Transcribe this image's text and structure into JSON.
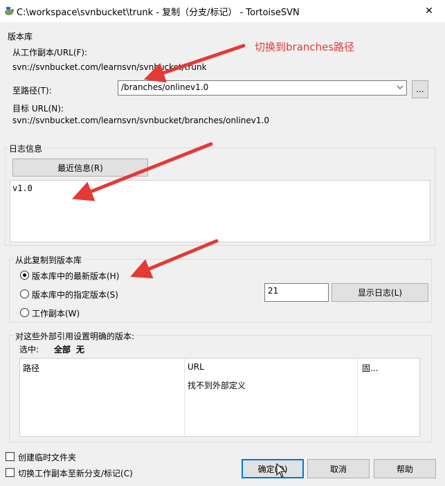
{
  "window": {
    "title": "C:\\workspace\\svnbucket\\trunk - 复制（分支/标记） - TortoiseSVN",
    "close_glyph": "✕"
  },
  "repository": {
    "group_label": "版本库",
    "from_label": "从工作副本/URL(F):",
    "from_url": "svn://svnbucket.com/learnsvn/svnbucket/trunk",
    "to_label": "至路径(T):",
    "to_value": "/branches/onlinev1.0",
    "browse_label": "...",
    "target_label": "目标 URL(N):",
    "target_url": "svn://svnbucket.com/learnsvn/svnbucket/branches/onlinev1.0"
  },
  "log": {
    "group_label": "日志信息",
    "recent_button": "最近信息(R)",
    "message": "v1.0"
  },
  "copy_from": {
    "group_label": "从此复制到版本库",
    "options": [
      {
        "label": "版本库中的最新版本(H)",
        "checked": true
      },
      {
        "label": "版本库中的指定版本(S)",
        "checked": false
      },
      {
        "label": "工作副本(W)",
        "checked": false
      }
    ],
    "revision_value": "21",
    "show_log_button": "显示日志(L)"
  },
  "externals": {
    "group_label": "对这些外部引用设置明确的版本:",
    "select_label": "选中:",
    "select_all": "全部",
    "select_none": "无",
    "columns": [
      "路径",
      "URL",
      "固..."
    ],
    "empty_message": "找不到外部定义"
  },
  "options": {
    "create_temp_folder": "创建临时文件夹",
    "switch_working_copy": "切换工作副本至新分支/标记(C)"
  },
  "buttons": {
    "ok": "确定(O)",
    "cancel": "取消",
    "help": "帮助"
  },
  "annotation": {
    "text": "切换到branches路径",
    "color": "#e53935"
  }
}
